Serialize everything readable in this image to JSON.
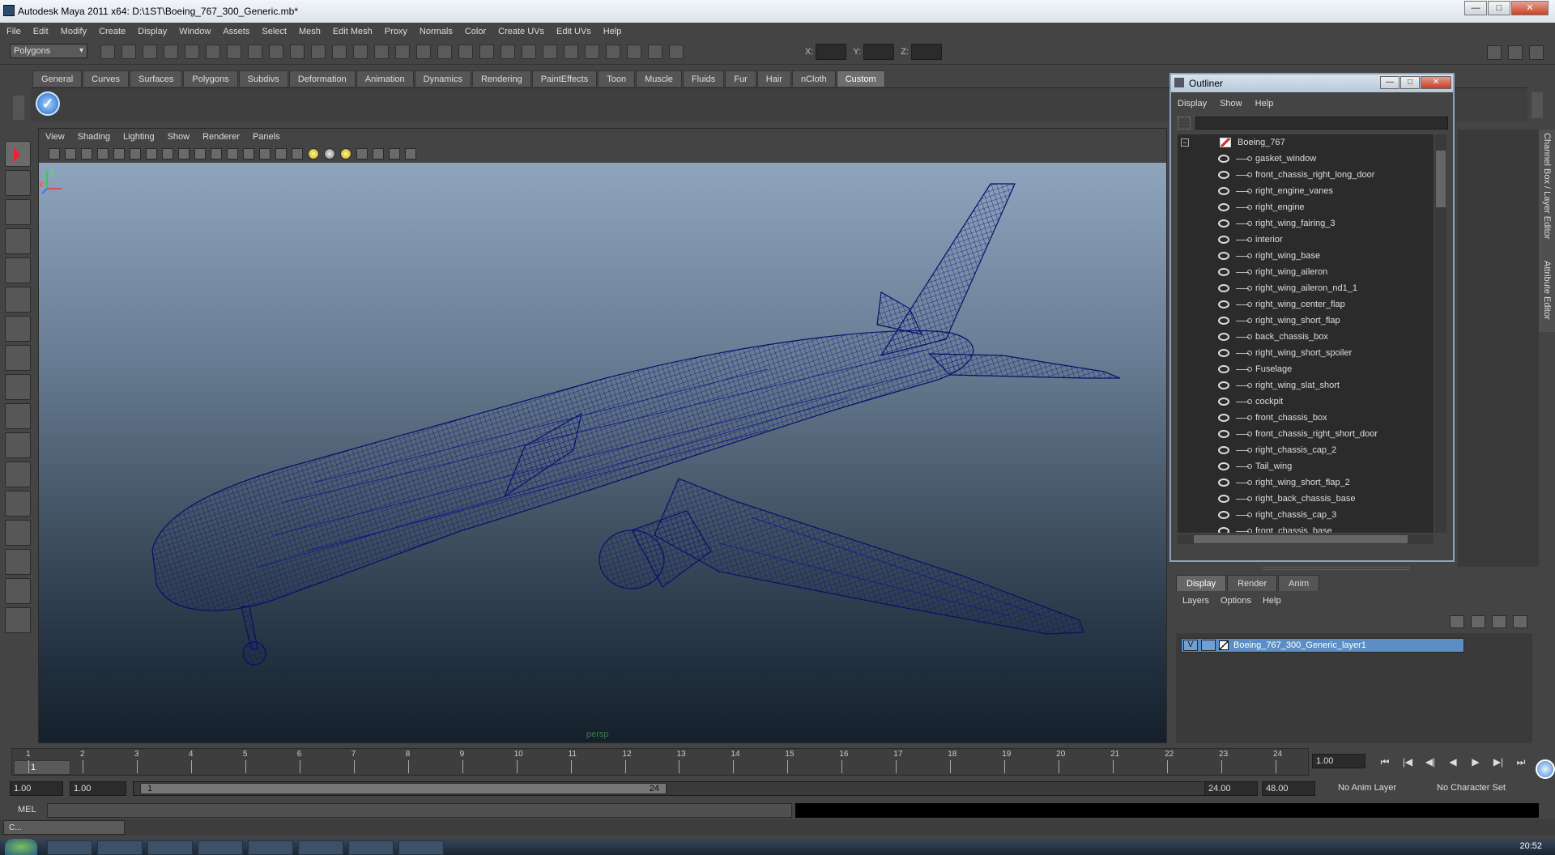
{
  "window": {
    "title": "Autodesk Maya 2011 x64: D:\\1ST\\Boeing_767_300_Generic.mb*",
    "min": "—",
    "max": "□",
    "close": "✕"
  },
  "menubar": [
    "File",
    "Edit",
    "Modify",
    "Create",
    "Display",
    "Window",
    "Assets",
    "Select",
    "Mesh",
    "Edit Mesh",
    "Proxy",
    "Normals",
    "Color",
    "Create UVs",
    "Edit UVs",
    "Help"
  ],
  "status": {
    "mode": "Polygons",
    "x_label": "X:",
    "y_label": "Y:",
    "z_label": "Z:"
  },
  "shelf": {
    "tabs": [
      "General",
      "Curves",
      "Surfaces",
      "Polygons",
      "Subdivs",
      "Deformation",
      "Animation",
      "Dynamics",
      "Rendering",
      "PaintEffects",
      "Toon",
      "Muscle",
      "Fluids",
      "Fur",
      "Hair",
      "nCloth",
      "Custom"
    ],
    "active": "Custom",
    "check_glyph": "✓"
  },
  "panel": {
    "menu": [
      "View",
      "Shading",
      "Lighting",
      "Show",
      "Renderer",
      "Panels"
    ],
    "camera": "persp",
    "axis_y": "y",
    "axis_x": "x"
  },
  "outliner": {
    "title": "Outliner",
    "menu": [
      "Display",
      "Show",
      "Help"
    ],
    "root": "Boeing_767",
    "expander": "−",
    "items": [
      "gasket_window",
      "front_chassis_right_long_door",
      "right_engine_vanes",
      "right_engine",
      "right_wing_fairing_3",
      "interior",
      "right_wing_base",
      "right_wing_aileron",
      "right_wing_aileron_nd1_1",
      "right_wing_center_flap",
      "right_wing_short_flap",
      "back_chassis_box",
      "right_wing_short_spoiler",
      "Fuselage",
      "right_wing_slat_short",
      "cockpit",
      "front_chassis_box",
      "front_chassis_right_short_door",
      "right_chassis_cap_2",
      "Tail_wing",
      "right_wing_short_flap_2",
      "right_back_chassis_base",
      "right_chassis_cap_3",
      "front_chassis_base"
    ],
    "btn_min": "—",
    "btn_max": "□",
    "btn_close": "✕"
  },
  "dock": {
    "channel_box_tab": "Channel Box / Layer Editor",
    "attr_tab": "Attribute Editor"
  },
  "layers": {
    "tabs": [
      "Display",
      "Render",
      "Anim"
    ],
    "active": "Display",
    "menu": [
      "Layers",
      "Options",
      "Help"
    ],
    "rows": [
      {
        "visible": "V",
        "name": "Boeing_767_300_Generic_layer1"
      }
    ]
  },
  "timeline": {
    "ticks": [
      "1",
      "2",
      "3",
      "4",
      "5",
      "6",
      "7",
      "8",
      "9",
      "10",
      "11",
      "12",
      "13",
      "14",
      "15",
      "16",
      "17",
      "18",
      "19",
      "20",
      "21",
      "22",
      "23",
      "24"
    ],
    "current": "1",
    "current_time_field": "1.00"
  },
  "playback_glyphs": [
    "⏮",
    "|◀",
    "◀|",
    "◀",
    "▶",
    "▶|",
    "⏭"
  ],
  "range": {
    "start_time": "1.00",
    "playback_start": "1.00",
    "slider_start": "1",
    "slider_end": "24",
    "playback_end": "24.00",
    "end_time": "48.00",
    "anim_layer": "No Anim Layer",
    "char_set": "No Character Set"
  },
  "cmd": {
    "label": "MEL"
  },
  "minimized": {
    "label": "C..."
  },
  "taskbar": {
    "time": "20:52"
  }
}
